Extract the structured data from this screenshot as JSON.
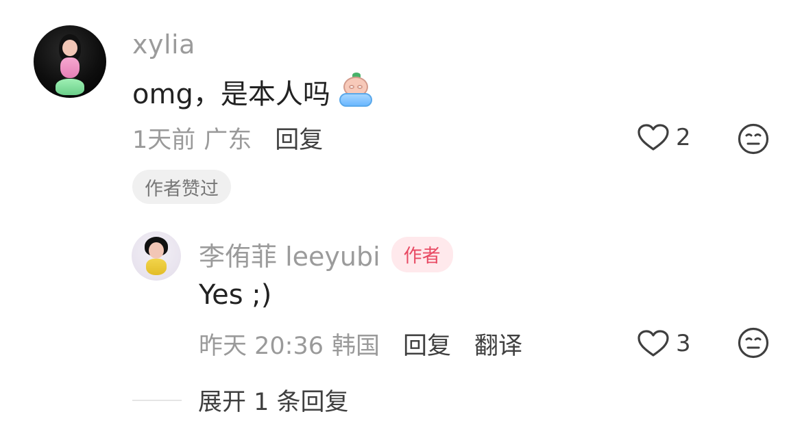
{
  "comment": {
    "username": "xylia",
    "text": "omg，是本人吗",
    "emoji": "crying-peach-sticker",
    "time": "1天前",
    "location": "广东",
    "reply_label": "回复",
    "likes": "2",
    "liked_by_author_badge": "作者赞过"
  },
  "reply": {
    "author_name": "李侑菲 leeyubi",
    "author_tag": "作者",
    "text": "Yes ;)",
    "time": "昨天 20:36",
    "location": "韩国",
    "reply_label": "回复",
    "translate_label": "翻译",
    "likes": "3"
  },
  "expand_replies": "展开 1 条回复",
  "icons": {
    "heart": "heart-outline-icon",
    "face": "neutral-face-icon"
  },
  "colors": {
    "muted_text": "#9b9b9b",
    "primary_text": "#222222",
    "author_tag_bg": "#ffe9ec",
    "author_tag_text": "#e84a63",
    "badge_bg": "#f0f0f0"
  }
}
